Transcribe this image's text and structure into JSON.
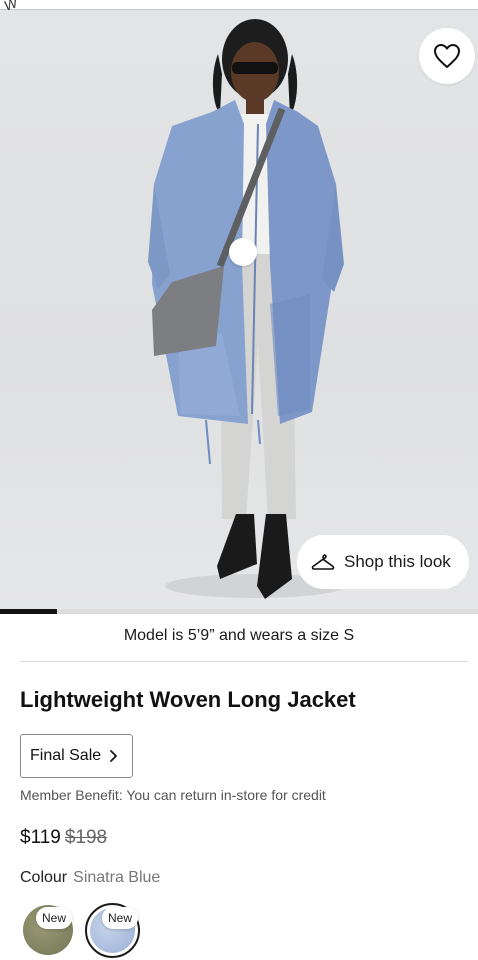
{
  "hero": {
    "corner_text": "W",
    "shop_look_label": "Shop this look"
  },
  "gallery": {
    "current_fraction": 0.12
  },
  "product": {
    "model_note": "Model is 5’9” and wears a size S",
    "title": "Lightweight Woven Long Jacket",
    "final_sale_label": "Final Sale",
    "member_benefit": "Member Benefit: You can return in-store for credit",
    "price_now": "$119",
    "price_was": "$198",
    "colour_label": "Colour",
    "colour_value": "Sinatra Blue"
  },
  "swatches": [
    {
      "badge": "New",
      "color": "#7f805e"
    },
    {
      "badge": "New",
      "color": "#a9bbdc",
      "selected": true
    }
  ],
  "icons": {
    "favorite": "heart-icon",
    "shop_look": "hanger-icon",
    "final_sale": "chevron-right-icon"
  }
}
